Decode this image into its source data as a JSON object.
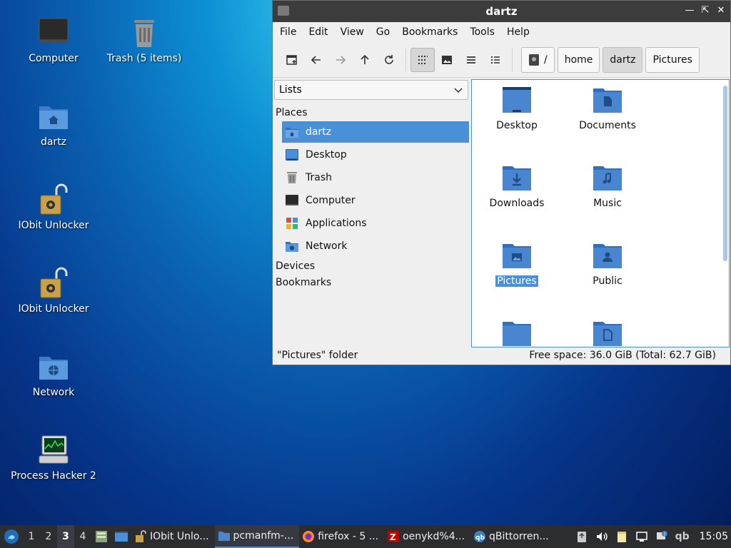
{
  "desktop": {
    "icons": [
      {
        "label": "Computer"
      },
      {
        "label": "Trash (5 items)"
      },
      {
        "label": "dartz"
      },
      {
        "label": "IObit Unlocker"
      },
      {
        "label": "IObit Unlocker"
      },
      {
        "label": "Network"
      },
      {
        "label": "Process Hacker 2"
      }
    ]
  },
  "window": {
    "title": "dartz",
    "menu": [
      "File",
      "Edit",
      "View",
      "Go",
      "Bookmarks",
      "Tools",
      "Help"
    ],
    "path": {
      "root": "/",
      "segments": [
        "home",
        "dartz",
        "Pictures"
      ]
    },
    "sidebar": {
      "mode": "Lists",
      "places_heading": "Places",
      "places": [
        {
          "label": "dartz",
          "icon": "home-folder-icon",
          "selected": true
        },
        {
          "label": "Desktop",
          "icon": "desktop-icon"
        },
        {
          "label": "Trash",
          "icon": "trash-icon"
        },
        {
          "label": "Computer",
          "icon": "computer-icon"
        },
        {
          "label": "Applications",
          "icon": "applications-icon"
        },
        {
          "label": "Network",
          "icon": "network-icon"
        }
      ],
      "devices_heading": "Devices",
      "bookmarks_heading": "Bookmarks"
    },
    "files": [
      {
        "label": "Desktop",
        "icon": "desktop-folder-icon"
      },
      {
        "label": "Documents",
        "icon": "documents-folder-icon"
      },
      {
        "label": "Downloads",
        "icon": "downloads-folder-icon"
      },
      {
        "label": "Music",
        "icon": "music-folder-icon"
      },
      {
        "label": "Pictures",
        "icon": "pictures-folder-icon",
        "selected": true
      },
      {
        "label": "Public",
        "icon": "public-folder-icon"
      },
      {
        "label": "",
        "icon": "folder-icon"
      },
      {
        "label": "",
        "icon": "templates-folder-icon"
      }
    ],
    "status": {
      "left": "\"Pictures\" folder",
      "right": "Free space: 36.0 GiB (Total: 62.7 GiB)"
    }
  },
  "taskbar": {
    "workspaces": [
      "1",
      "2",
      "3",
      "4"
    ],
    "active_workspace": "3",
    "tasks": [
      {
        "label": "IObit Unlo..."
      },
      {
        "label": "pcmanfm-...",
        "active": true
      },
      {
        "label": "firefox - 5 ..."
      },
      {
        "label": "oenykd%4..."
      },
      {
        "label": "qBittorren..."
      }
    ],
    "tray_text": "qb",
    "clock": "15:05"
  },
  "colors": {
    "accent": "#4a90d9",
    "folder": "#4a86cf",
    "titlebar": "#3c3c3c",
    "taskbar": "#2b2d31"
  }
}
